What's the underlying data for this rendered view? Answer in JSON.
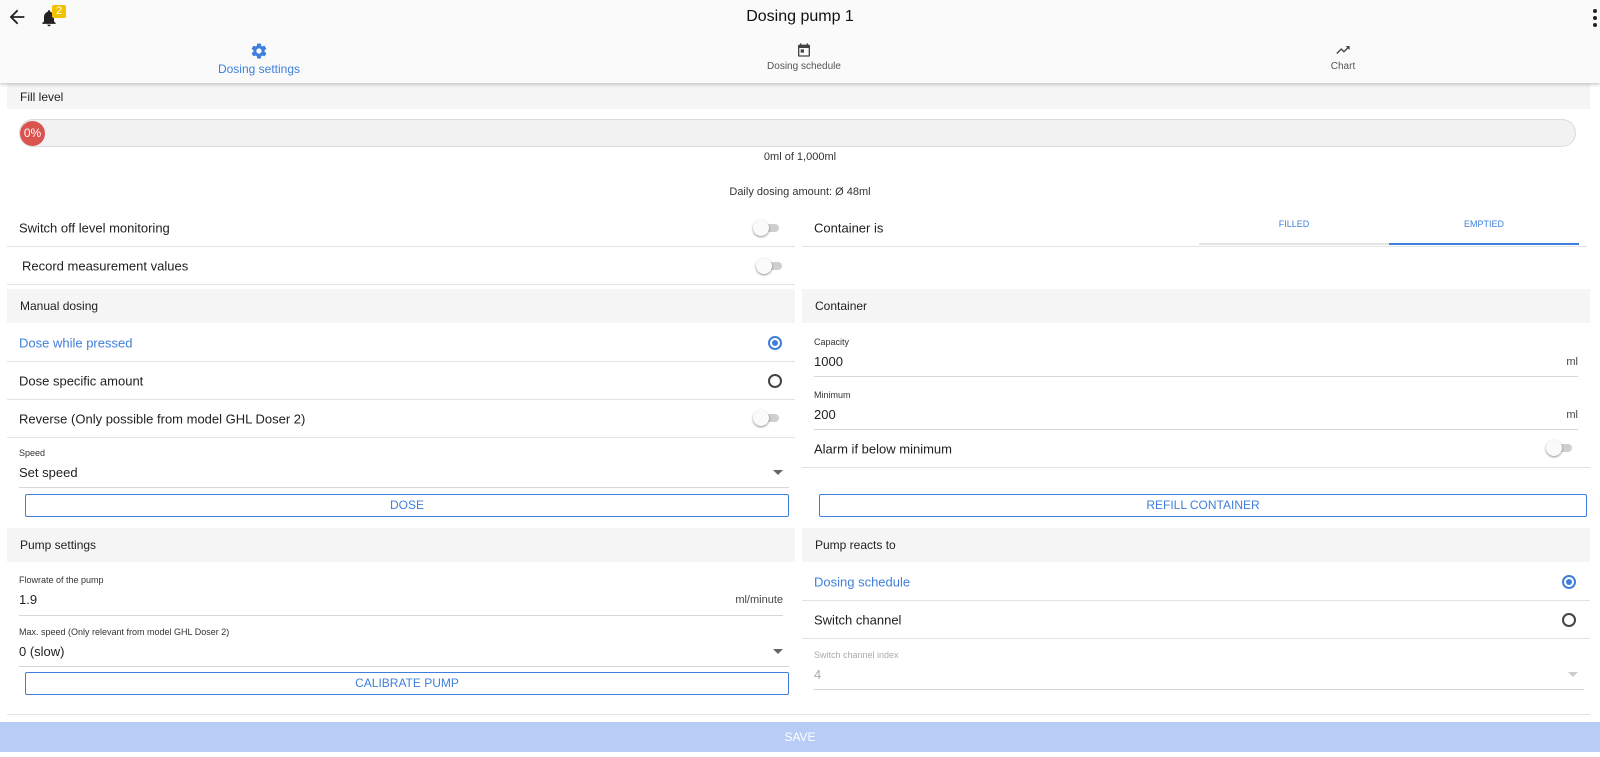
{
  "header": {
    "title": "Dosing pump 1",
    "notification_count": "2"
  },
  "tabs": [
    {
      "label": "Dosing settings",
      "icon": "gear-icon",
      "active": true
    },
    {
      "label": "Dosing schedule",
      "icon": "calendar-icon",
      "active": false
    },
    {
      "label": "Chart",
      "icon": "trending-up-icon",
      "active": false
    }
  ],
  "fill_level": {
    "heading": "Fill level",
    "percent_label": "0%",
    "percent": 0,
    "amount_text": "0ml of 1,000ml",
    "daily_text": "Daily dosing amount: Ø 48ml"
  },
  "monitoring": {
    "switch_off_label": "Switch off level monitoring",
    "switch_off_on": false,
    "record_label": "Record measurement values",
    "record_on": false
  },
  "container_state": {
    "label": "Container is",
    "options": [
      "FILLED",
      "EMPTIED"
    ],
    "selected": "EMPTIED"
  },
  "manual_dosing": {
    "heading": "Manual dosing",
    "dose_while_pressed": "Dose while pressed",
    "dose_specific": "Dose specific amount",
    "selected": "Dose while pressed",
    "reverse_label": "Reverse (Only possible from model GHL Doser 2)",
    "reverse_on": false,
    "speed_label": "Speed",
    "speed_value": "Set speed",
    "dose_button": "DOSE"
  },
  "container": {
    "heading": "Container",
    "capacity_label": "Capacity",
    "capacity_value": "1000",
    "capacity_unit": "ml",
    "minimum_label": "Minimum",
    "minimum_value": "200",
    "minimum_unit": "ml",
    "alarm_label": "Alarm if below minimum",
    "alarm_on": false,
    "refill_button": "REFILL CONTAINER"
  },
  "pump_settings": {
    "heading": "Pump settings",
    "flowrate_label": "Flowrate of the pump",
    "flowrate_value": "1.9",
    "flowrate_unit": "ml/minute",
    "max_speed_label": "Max. speed (Only relevant from model GHL Doser 2)",
    "max_speed_value": "0 (slow)",
    "calibrate_button": "CALIBRATE PUMP"
  },
  "pump_reacts": {
    "heading": "Pump reacts to",
    "dosing_schedule": "Dosing schedule",
    "switch_channel": "Switch channel",
    "selected": "Dosing schedule",
    "channel_index_label": "Switch channel index",
    "channel_index_value": "4"
  },
  "footer": {
    "save_label": "SAVE"
  },
  "colors": {
    "accent": "#3f7fdb",
    "fill_indicator": "#d9534f",
    "badge": "#f2c200",
    "save_disabled": "#b7cdf6"
  }
}
